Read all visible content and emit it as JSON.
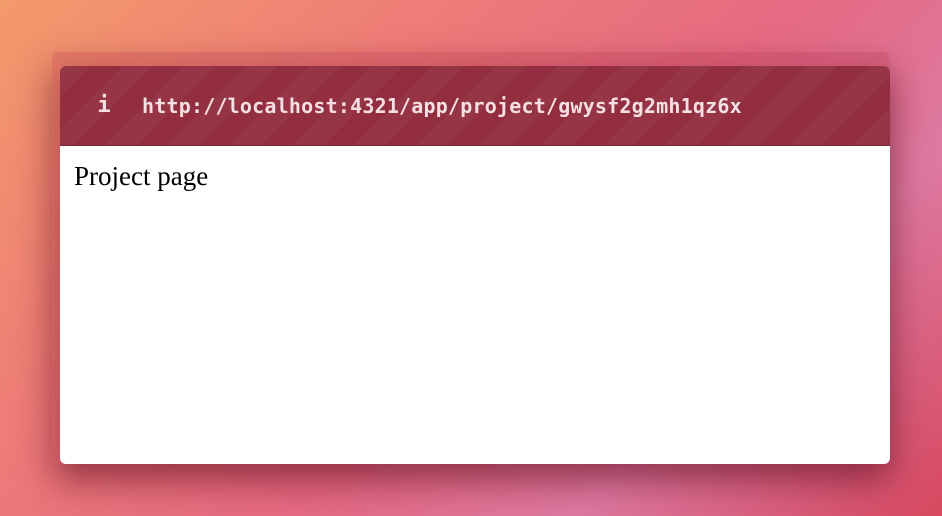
{
  "url_bar": {
    "icon": "info-icon",
    "icon_glyph": "i",
    "url": "http://localhost:4321/app/project/gwysf2g2mh1qz6x"
  },
  "page": {
    "body_text": "Project page"
  },
  "colors": {
    "url_bar_background": "#922e3f",
    "url_text": "#f4dfe3",
    "page_background": "#ffffff"
  }
}
